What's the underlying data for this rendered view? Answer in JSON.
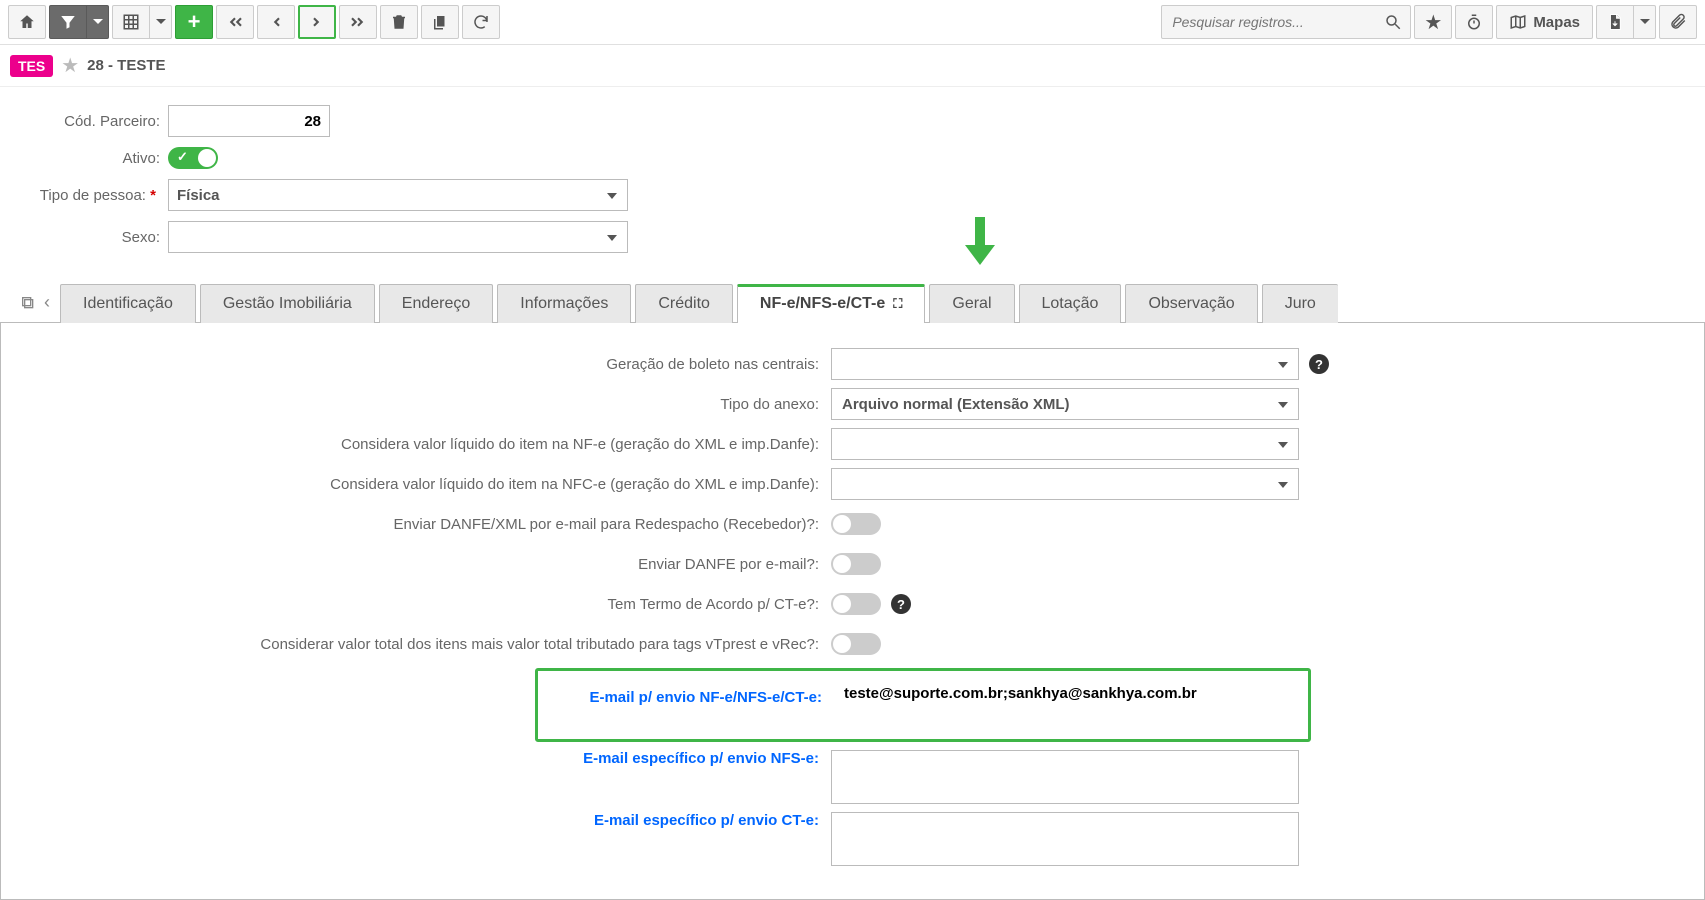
{
  "toolbar": {
    "search_placeholder": "Pesquisar registros...",
    "maps_label": "Mapas"
  },
  "breadcrumb": {
    "badge": "TES",
    "title": "28 - TESTE"
  },
  "form": {
    "codParceiro_label": "Cód. Parceiro:",
    "codParceiro_value": "28",
    "ativo_label": "Ativo:",
    "tipoPessoa_label": "Tipo de pessoa:",
    "tipoPessoa_value": "Física",
    "sexo_label": "Sexo:",
    "sexo_value": ""
  },
  "tabs": [
    {
      "label": "Identificação"
    },
    {
      "label": "Gestão Imobiliária"
    },
    {
      "label": "Endereço"
    },
    {
      "label": "Informações"
    },
    {
      "label": "Crédito"
    },
    {
      "label": "NF-e/NFS-e/CT-e",
      "active": true
    },
    {
      "label": "Geral"
    },
    {
      "label": "Lotação"
    },
    {
      "label": "Observação"
    },
    {
      "label": "Juro"
    }
  ],
  "panel": {
    "geracao_boleto_label": "Geração de boleto nas centrais:",
    "geracao_boleto_value": "",
    "tipo_anexo_label": "Tipo do anexo:",
    "tipo_anexo_value": "Arquivo normal (Extensão XML)",
    "considera_nfe_label": "Considera valor líquido do item na NF-e (geração do XML e imp.Danfe):",
    "considera_nfe_value": "",
    "considera_nfce_label": "Considera valor líquido do item na NFC-e (geração do XML e imp.Danfe):",
    "considera_nfce_value": "",
    "enviar_danfe_xml_label": "Enviar DANFE/XML por e-mail para Redespacho (Recebedor)?:",
    "enviar_danfe_label": "Enviar DANFE por e-mail?:",
    "termo_acordo_label": "Tem Termo de Acordo p/ CT-e?:",
    "considerar_total_label": "Considerar valor total dos itens mais valor total tributado para tags vTprest e vRec?:",
    "email_nfe_label": "E-mail p/ envio NF-e/NFS-e/CT-e:",
    "email_nfe_value": "teste@suporte.com.br;sankhya@sankhya.com.br",
    "email_nfse_label": "E-mail específico p/ envio NFS-e:",
    "email_nfse_value": "",
    "email_cte_label": "E-mail específico p/ envio CT-e:",
    "email_cte_value": ""
  }
}
